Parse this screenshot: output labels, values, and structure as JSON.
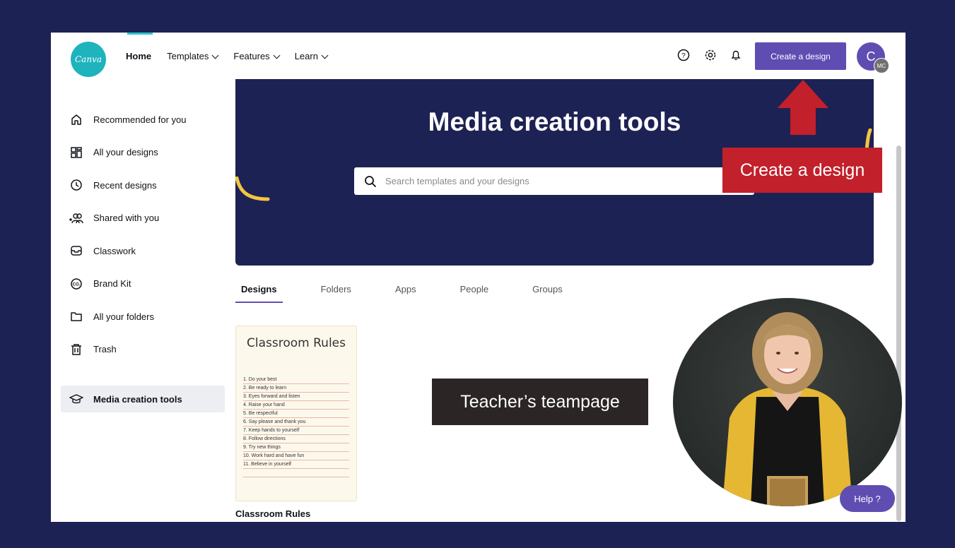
{
  "header": {
    "logo_text": "Canva",
    "nav": [
      {
        "label": "Home"
      },
      {
        "label": "Templates"
      },
      {
        "label": "Features"
      },
      {
        "label": "Learn"
      }
    ],
    "icons": [
      "help-circle-icon",
      "gear-icon",
      "bell-icon"
    ],
    "create_button": "Create a design",
    "avatar_initial": "C",
    "avatar_sub": "MC"
  },
  "sidebar": {
    "items": [
      {
        "label": "Recommended for you",
        "icon": "home-icon"
      },
      {
        "label": "All your designs",
        "icon": "grid-icon"
      },
      {
        "label": "Recent designs",
        "icon": "clock-icon"
      },
      {
        "label": "Shared with you",
        "icon": "people-icon"
      },
      {
        "label": "Classwork",
        "icon": "inbox-icon"
      },
      {
        "label": "Brand Kit",
        "icon": "brand-kit-icon"
      },
      {
        "label": "All your folders",
        "icon": "folder-icon"
      },
      {
        "label": "Trash",
        "icon": "trash-icon"
      }
    ],
    "active": {
      "label": "Media creation tools",
      "icon": "graduation-cap-icon"
    }
  },
  "hero": {
    "title": "Media creation tools",
    "search_placeholder": "Search templates and your designs"
  },
  "tabs": [
    {
      "label": "Designs"
    },
    {
      "label": "Folders"
    },
    {
      "label": "Apps"
    },
    {
      "label": "People"
    },
    {
      "label": "Groups"
    }
  ],
  "design_card": {
    "thumb_title": "Classroom Rules",
    "rules": [
      "1. Do your best",
      "2. Be ready to learn",
      "3. Eyes forward and listen",
      "4. Raise your hand",
      "5. Be respectful",
      "6. Say please and thank you",
      "7. Keep hands to yourself",
      "8. Follow directions",
      "9. Try new things",
      "10. Work hard and have fun",
      "11. Believe in yourself"
    ],
    "label": "Classroom Rules"
  },
  "overlays": {
    "create_callout": "Create a design",
    "teacher_label": "Teacher’s teampage"
  },
  "help_button": "Help ?",
  "colors": {
    "background": "#1d2254",
    "brand_purple": "#5f4db2",
    "canva_teal": "#1fb3bd",
    "callout_red": "#c2202a"
  }
}
